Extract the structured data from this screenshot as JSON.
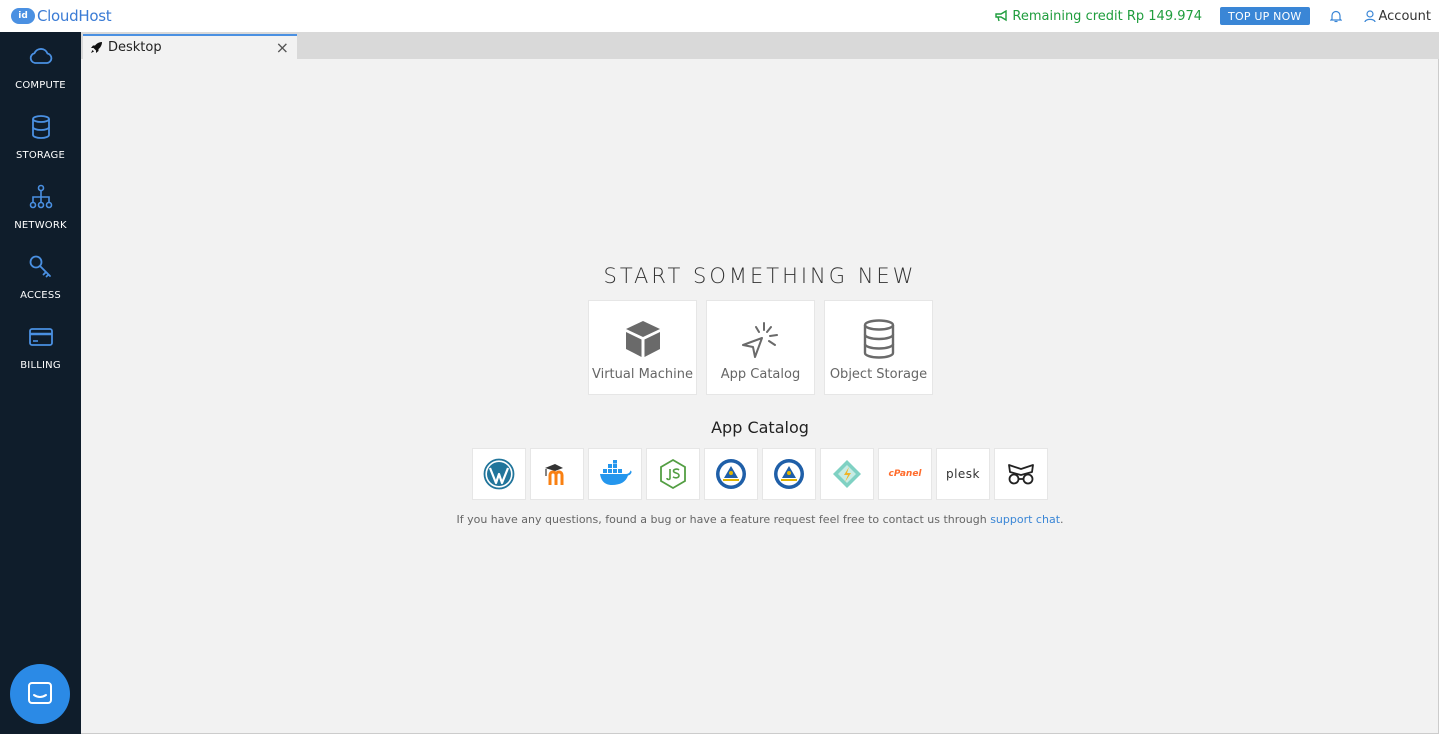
{
  "brand": {
    "badge": "id",
    "name": "CloudHost"
  },
  "header": {
    "credit": "Remaining credit Rp 149.974",
    "topup_label": "TOP UP NOW",
    "account_label": "Account"
  },
  "sidebar": {
    "items": [
      {
        "label": "COMPUTE",
        "icon": "cloud-icon"
      },
      {
        "label": "STORAGE",
        "icon": "database-icon"
      },
      {
        "label": "NETWORK",
        "icon": "network-icon"
      },
      {
        "label": "ACCESS",
        "icon": "key-icon"
      },
      {
        "label": "BILLING",
        "icon": "credit-card-icon"
      }
    ]
  },
  "tab": {
    "label": "Desktop",
    "close": "×"
  },
  "main": {
    "headline": "START SOMETHING NEW",
    "cards": [
      {
        "label": "Virtual Machine",
        "icon": "cube-icon"
      },
      {
        "label": "App Catalog",
        "icon": "cursor-click-icon"
      },
      {
        "label": "Object Storage",
        "icon": "database-icon"
      }
    ],
    "catalog_title": "App Catalog",
    "apps": [
      "wordpress-icon",
      "moodle-icon",
      "docker-icon",
      "nodejs-icon",
      "tutwuri-icon",
      "tutwuri-icon",
      "diamond-app-icon",
      "cpanel-icon",
      "plesk-icon",
      "mask-app-icon"
    ],
    "apps_text": {
      "plesk": "plesk",
      "cpanel": "cPanel"
    },
    "footnote_text": "If you have any questions, found a bug or have a feature request feel free to contact us through ",
    "footnote_link": "support chat",
    "footnote_end": "."
  },
  "colors": {
    "accent": "#4a90e2",
    "sidebar": "#0f1d2b",
    "credit": "#1f9d3d"
  }
}
